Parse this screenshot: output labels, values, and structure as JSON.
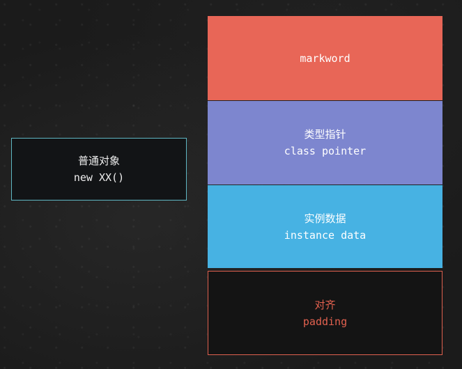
{
  "object": {
    "label_cn": "普通对象",
    "label_code": "new XX()"
  },
  "layout_blocks": [
    {
      "label": "markword",
      "color": "#e86657"
    },
    {
      "label_cn": "类型指针",
      "label_en": "class pointer",
      "color": "#7d86cf"
    },
    {
      "label_cn": "实例数据",
      "label_en": "instance data",
      "color": "#47b2e3"
    },
    {
      "label_cn": "对齐",
      "label_en": "padding",
      "color": "#e0614f"
    }
  ]
}
